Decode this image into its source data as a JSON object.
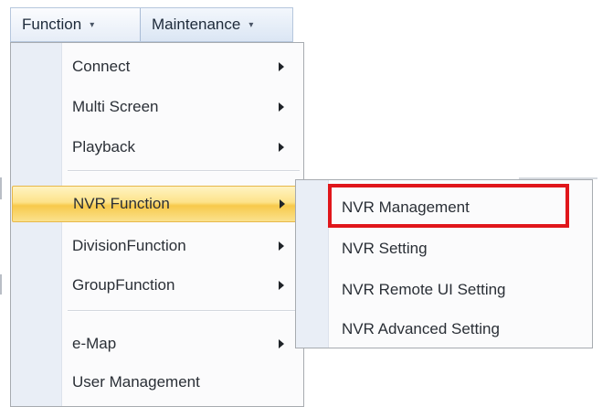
{
  "menubar": {
    "items": [
      {
        "label": "Function",
        "caret": "▾"
      },
      {
        "label": "Maintenance",
        "caret": "▾"
      }
    ]
  },
  "function_menu": {
    "items": [
      {
        "label": "Connect",
        "has_submenu": true
      },
      {
        "label": "Multi Screen",
        "has_submenu": true
      },
      {
        "label": "Playback",
        "has_submenu": true
      },
      {
        "label": "NVR Function",
        "has_submenu": true,
        "highlighted": true
      },
      {
        "label": "DivisionFunction",
        "has_submenu": true
      },
      {
        "label": "GroupFunction",
        "has_submenu": true
      },
      {
        "label": "e-Map",
        "has_submenu": true
      },
      {
        "label": "User Management",
        "has_submenu": false
      }
    ]
  },
  "nvr_submenu": {
    "items": [
      {
        "label": "NVR Management",
        "emphasized": true
      },
      {
        "label": "NVR Setting"
      },
      {
        "label": "NVR Remote UI Setting"
      },
      {
        "label": "NVR Advanced Setting"
      }
    ]
  },
  "colors": {
    "highlight_gradient_top": "#fff3c2",
    "highlight_gradient_bottom": "#f7c94b",
    "emphasis_box": "#e0161b",
    "menubar_bg": "#dbe6f4"
  }
}
